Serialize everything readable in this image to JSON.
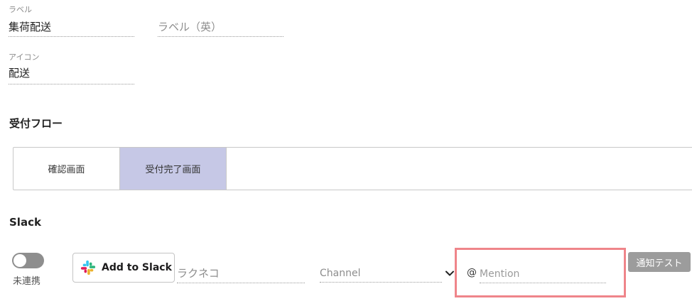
{
  "label_field": {
    "caption": "ラベル",
    "value": "集荷配送",
    "en_placeholder": "ラベル（英）"
  },
  "icon_field": {
    "caption": "アイコン",
    "value": "配送"
  },
  "flow": {
    "title": "受付フロー",
    "tabs": [
      {
        "label": "確認画面",
        "active": false
      },
      {
        "label": "受付完了画面",
        "active": true
      }
    ]
  },
  "slack": {
    "title": "Slack",
    "toggle_label": "未連携",
    "toggle_on": false,
    "add_button_label": "Add to Slack",
    "workspace_placeholder": "ラクネコ",
    "channel_placeholder": "Channel",
    "mention_prefix": "@",
    "mention_placeholder": "Mention",
    "test_button_label": "通知テスト"
  },
  "colors": {
    "active_tab": "#c6c8e6",
    "highlight_border": "#ef858a",
    "test_button": "#9c9c9c",
    "toggle_off": "#8e8e8e"
  }
}
